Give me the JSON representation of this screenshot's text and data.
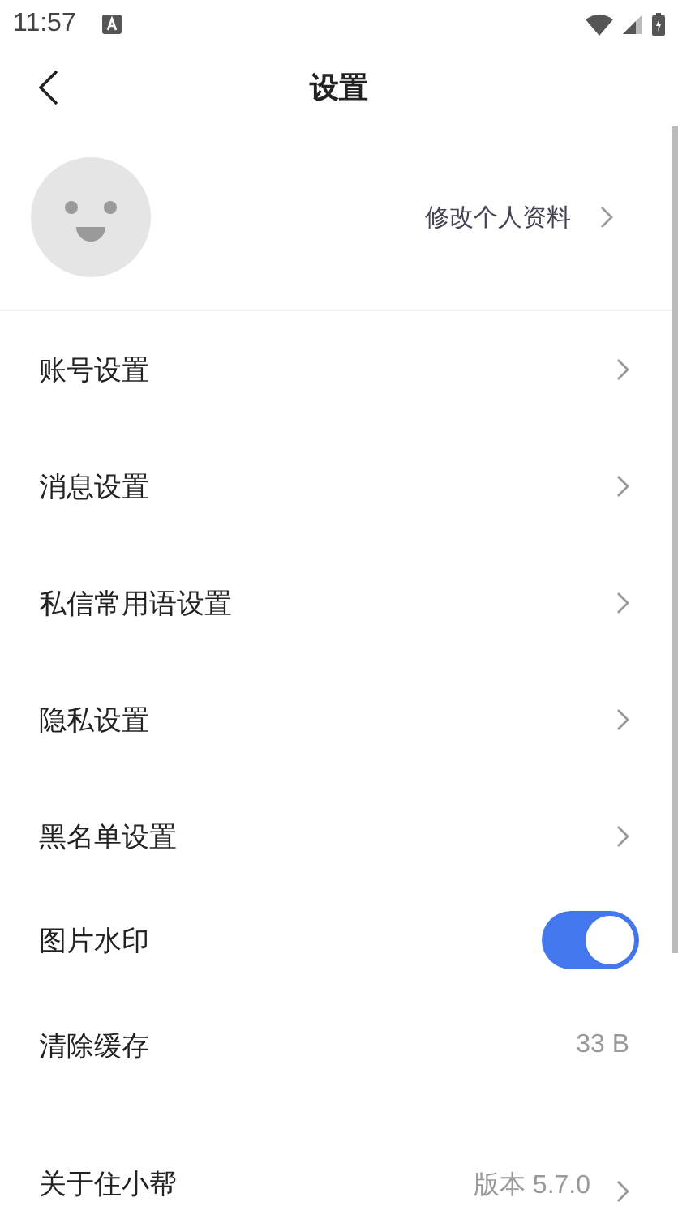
{
  "status_bar": {
    "time": "11:57"
  },
  "header": {
    "title": "设置"
  },
  "profile": {
    "edit_label": "修改个人资料"
  },
  "items": [
    {
      "kind": "link",
      "label": "账号设置"
    },
    {
      "kind": "link",
      "label": "消息设置"
    },
    {
      "kind": "link",
      "label": "私信常用语设置"
    },
    {
      "kind": "link",
      "label": "隐私设置"
    },
    {
      "kind": "link",
      "label": "黑名单设置"
    },
    {
      "kind": "toggle",
      "label": "图片水印",
      "on": true
    },
    {
      "kind": "value",
      "label": "清除缓存",
      "value": "33 B"
    },
    {
      "kind": "link",
      "label": "关于住小帮",
      "value": "版本 5.7.0"
    }
  ]
}
